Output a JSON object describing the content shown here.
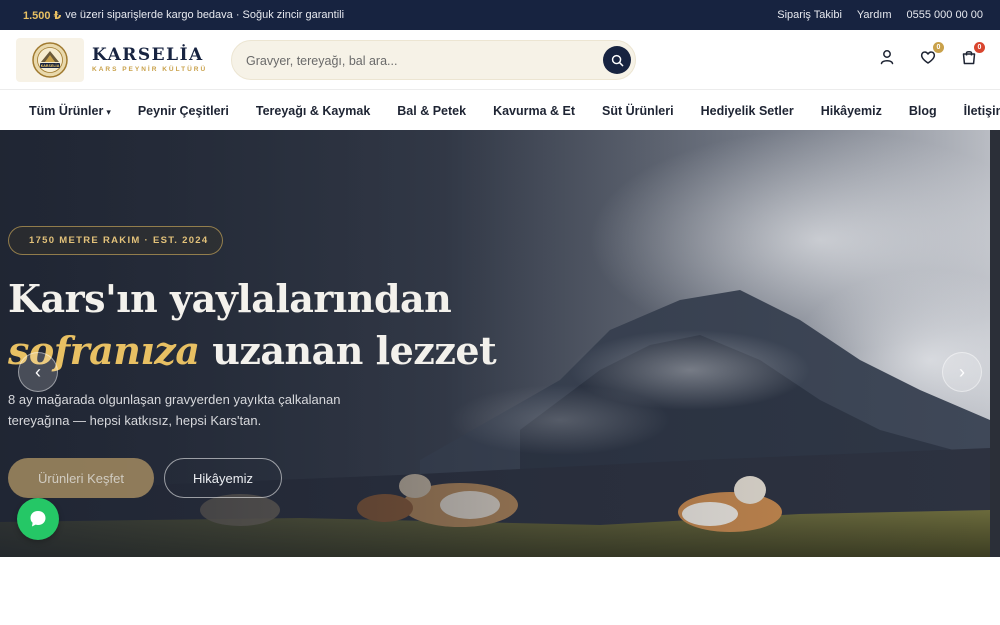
{
  "topbar": {
    "promo_highlight": "1.500 ₺",
    "promo_text": "ve üzeri siparişlerde kargo bedava · Soğuk zincir garantili",
    "links": [
      "Sipariş Takibi",
      "Yardım",
      "0555 000 00 00"
    ]
  },
  "header": {
    "logo_text": "KARSELİA",
    "brand_name": "KARSELİA",
    "brand_tagline": "KARS PEYNİR KÜLTÜRÜ",
    "search_placeholder": "Gravyer, tereyağı, bal ara...",
    "wishlist_count": "0",
    "cart_count": "0",
    "icons": [
      "account-icon",
      "heart-icon",
      "cart-icon",
      "search-icon"
    ]
  },
  "nav": {
    "items": [
      "Tüm Ürünler",
      "Peynir Çeşitleri",
      "Tereyağı & Kaymak",
      "Bal & Petek",
      "Kavurma & Et",
      "Süt Ürünleri",
      "Hediyelik Setler",
      "Hikâyemiz",
      "Blog",
      "İletişim"
    ],
    "dropdown_caret": "▾"
  },
  "hero": {
    "pill": "1750 METRE RAKIM · EST. 2024",
    "title_line1": "Kars'ın yaylalarından",
    "title_gold": "sofranıza",
    "title_rest": " uzanan lezzet",
    "subtitle": "8 ay mağarada olgunlaşan gravyerden yayıkta çalkalanan tereyağına — hepsi katkısız, hepsi Kars'tan.",
    "primary_button": "Ürünleri Keşfet",
    "secondary_button": "Hikâyemiz",
    "prev_arrow": "‹",
    "next_arrow": "›"
  },
  "colors": {
    "navy": "#172340",
    "gold": "#e8c063",
    "chat_green": "#25c766",
    "wishlist_badge": "#c9a14a",
    "cart_badge": "#d9452e"
  }
}
